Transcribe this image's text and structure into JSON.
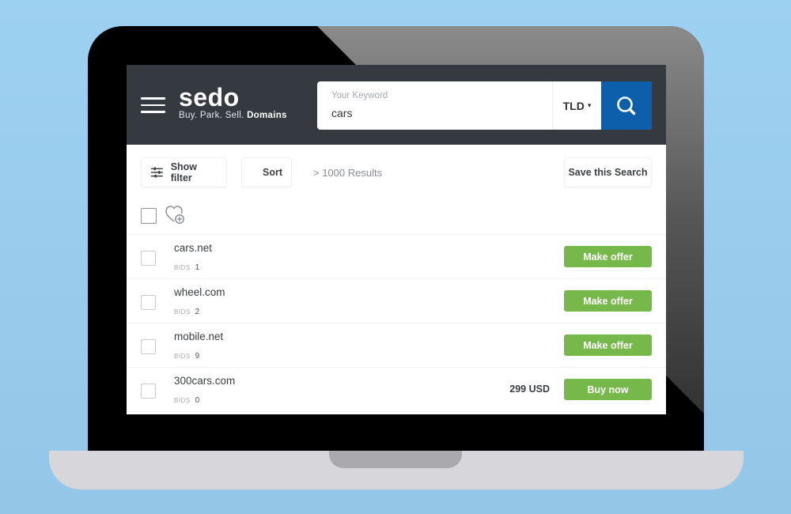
{
  "colors": {
    "background": "#9dd1f1",
    "header_bg": "#343a40",
    "search_button": "#0d5fac",
    "action_button": "#77b84a"
  },
  "header": {
    "menu_icon": "hamburger-icon",
    "logo_name": "sedo",
    "tagline_prefix": "Buy. Park. Sell.",
    "tagline_bold": "Domains"
  },
  "search": {
    "label": "Your Keyword",
    "value": "cars",
    "tld_label": "TLD",
    "tld_caret": "▾",
    "search_icon": "search-icon"
  },
  "toolbar": {
    "filter_label": "Show filter",
    "sort_label": "Sort",
    "results_text": "> 1000 Results",
    "save_label": "Save this Search"
  },
  "list": {
    "bids_label": "BIDS",
    "rows": [
      {
        "domain": "cars.net",
        "bids": "1",
        "price": "",
        "action": "Make offer"
      },
      {
        "domain": "wheel.com",
        "bids": "2",
        "price": "",
        "action": "Make offer"
      },
      {
        "domain": "mobile.net",
        "bids": "9",
        "price": "",
        "action": "Make offer"
      },
      {
        "domain": "300cars.com",
        "bids": "0",
        "price": "299 USD",
        "action": "Buy now"
      }
    ]
  }
}
